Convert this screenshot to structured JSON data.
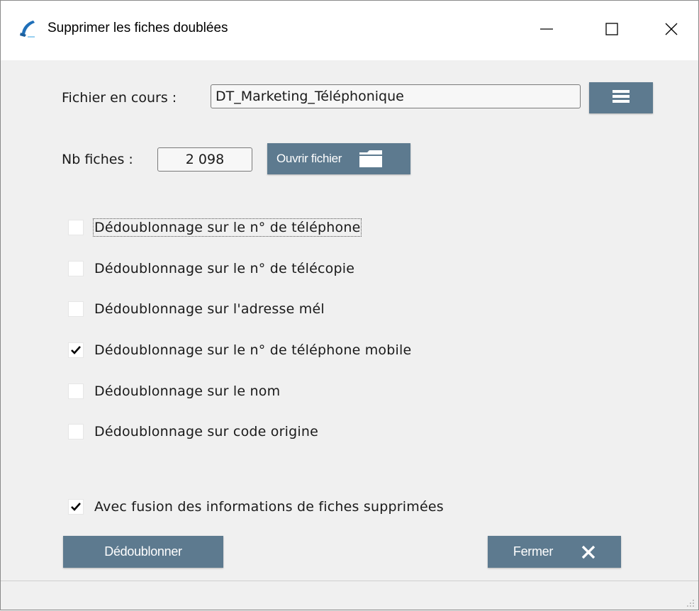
{
  "window": {
    "title": "Supprimer les fiches doublées"
  },
  "controls": {
    "minimize_icon": "minimize-icon",
    "maximize_icon": "maximize-icon",
    "close_icon": "close-icon"
  },
  "file": {
    "label": "Fichier en cours :",
    "value": "DT_Marketing_Téléphonique",
    "menu_icon": "hamburger-menu-icon"
  },
  "count": {
    "label": "Nb fiches :",
    "value": "2 098",
    "open_button": "Ouvrir fichier",
    "open_icon": "folder-icon"
  },
  "options": [
    {
      "label": "Dédoublonnage sur le n° de téléphone",
      "checked": false
    },
    {
      "label": "Dédoublonnage sur le n° de télécopie",
      "checked": false
    },
    {
      "label": "Dédoublonnage sur l'adresse mél",
      "checked": false
    },
    {
      "label": "Dédoublonnage sur le n° de téléphone mobile",
      "checked": true
    },
    {
      "label": "Dédoublonnage sur le nom",
      "checked": false
    },
    {
      "label": "Dédoublonnage sur code origine",
      "checked": false
    }
  ],
  "merge": {
    "label": "Avec fusion des informations de fiches supprimées",
    "checked": true
  },
  "actions": {
    "dedup_button": "Dédoublonner",
    "close_button": "Fermer",
    "close_icon": "close-icon"
  },
  "colors": {
    "button_bg": "#5d7a8f",
    "button_text": "#ffffff",
    "window_bg": "#f0f0f0"
  }
}
